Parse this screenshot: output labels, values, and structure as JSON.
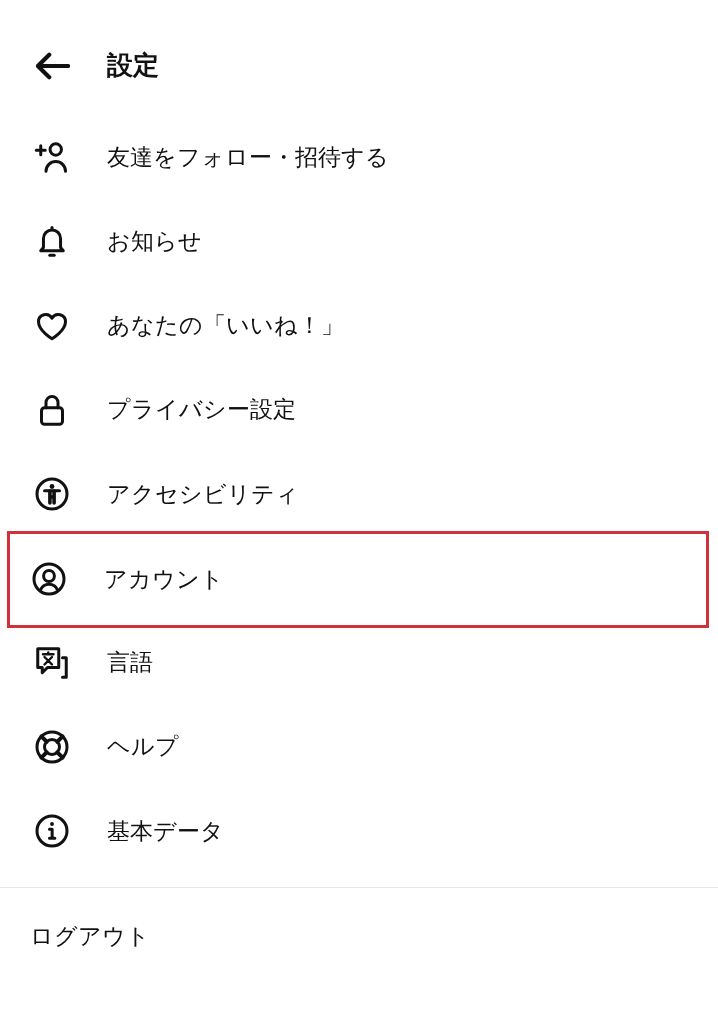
{
  "header": {
    "title": "設定"
  },
  "items": [
    {
      "kind": "friends",
      "label": "友達をフォロー・招待する",
      "highlighted": false
    },
    {
      "kind": "notifications",
      "label": "お知らせ",
      "highlighted": false
    },
    {
      "kind": "likes",
      "label": "あなたの「いいね！」",
      "highlighted": false
    },
    {
      "kind": "privacy",
      "label": "プライバシー設定",
      "highlighted": false
    },
    {
      "kind": "accessibility",
      "label": "アクセシビリティ",
      "highlighted": false
    },
    {
      "kind": "account",
      "label": "アカウント",
      "highlighted": true
    },
    {
      "kind": "language",
      "label": "言語",
      "highlighted": false
    },
    {
      "kind": "help",
      "label": "ヘルプ",
      "highlighted": false
    },
    {
      "kind": "about",
      "label": "基本データ",
      "highlighted": false
    }
  ],
  "logout": {
    "label": "ログアウト"
  }
}
